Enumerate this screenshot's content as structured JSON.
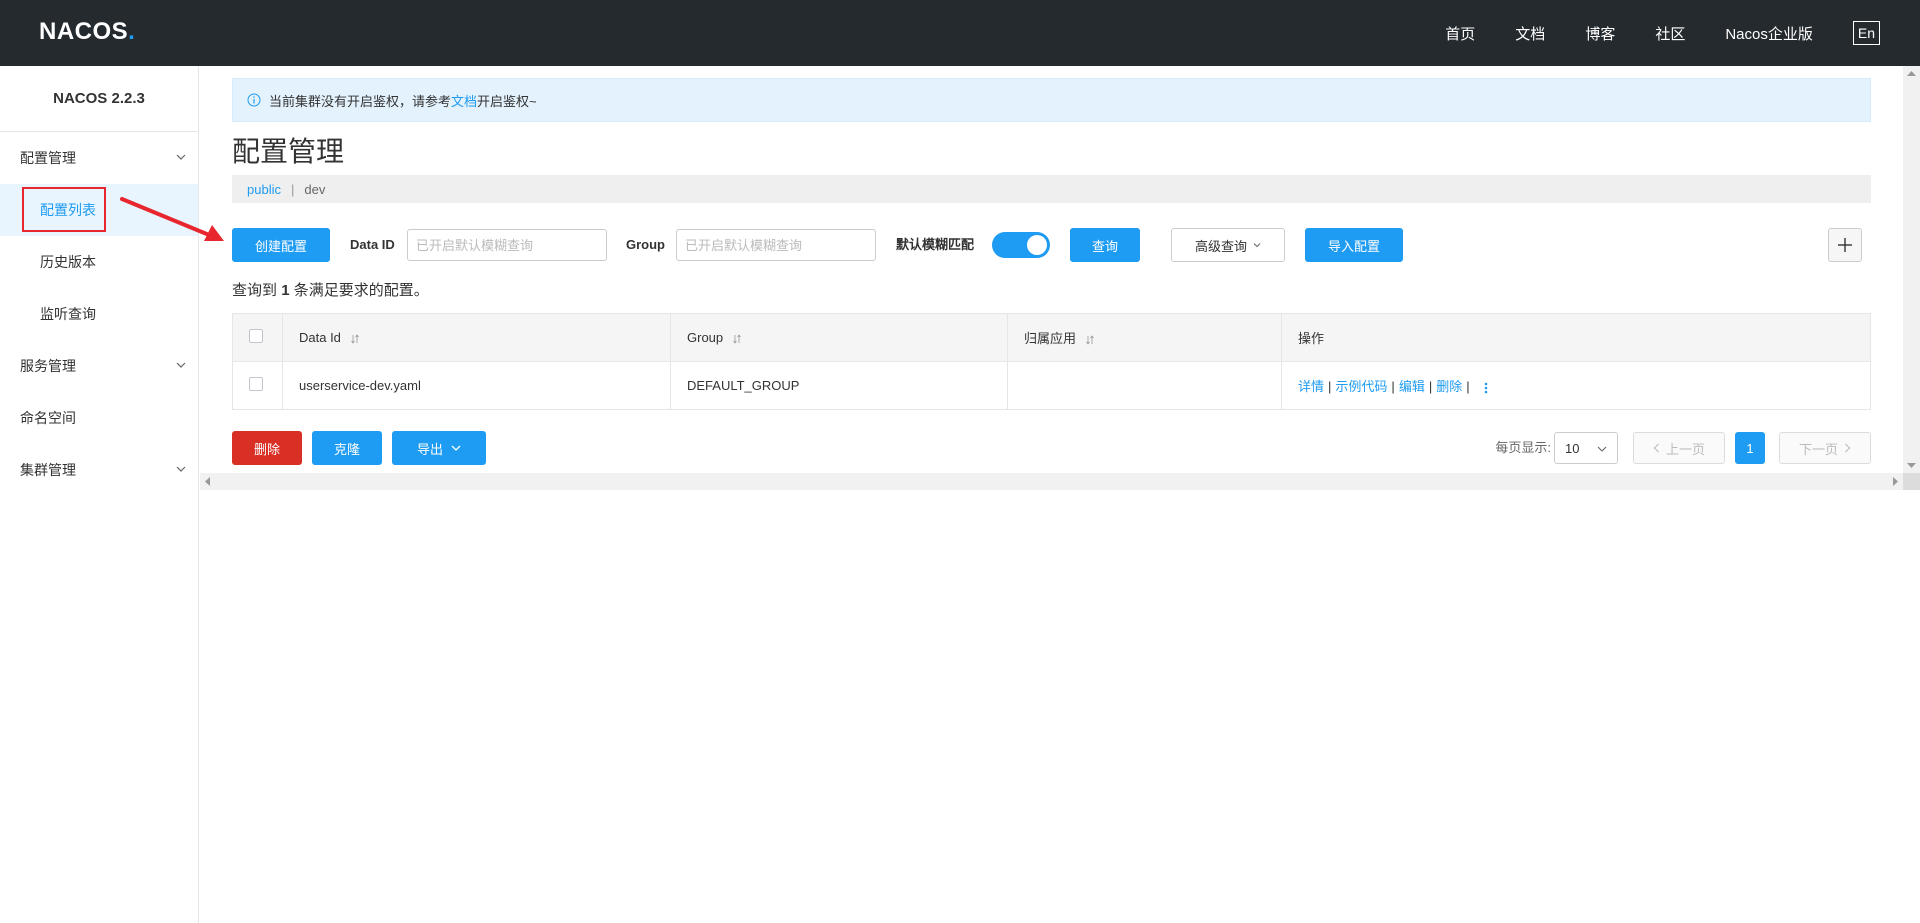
{
  "header": {
    "logo": {
      "text": "NACOS",
      "dot": "."
    },
    "nav": [
      "首页",
      "文档",
      "博客",
      "社区",
      "Nacos企业版"
    ],
    "lang": "En"
  },
  "sidebar": {
    "version": "NACOS 2.2.3",
    "groups": [
      {
        "label": "配置管理",
        "items": [
          "配置列表",
          "历史版本",
          "监听查询"
        ]
      },
      {
        "label": "服务管理"
      },
      {
        "label": "命名空间"
      },
      {
        "label": "集群管理"
      }
    ]
  },
  "notice": {
    "text_before": "当前集群没有开启鉴权，请参考",
    "link": "文档",
    "text_after": "开启鉴权~"
  },
  "page": {
    "title": "配置管理",
    "namespaces": {
      "public": "public",
      "separator": "|",
      "dev": "dev"
    }
  },
  "toolbar": {
    "create_label": "创建配置",
    "dataid_label": "Data ID",
    "dataid_placeholder": "已开启默认模糊查询",
    "group_label": "Group",
    "group_placeholder": "已开启默认模糊查询",
    "fuzzy_label": "默认模糊匹配",
    "fuzzy_enabled": true,
    "query_label": "查询",
    "advanced_label": "高级查询",
    "import_label": "导入配置"
  },
  "results": {
    "prefix": "查询到",
    "count": "1",
    "suffix": "条满足要求的配置。"
  },
  "table": {
    "columns": [
      "Data Id",
      "Group",
      "归属应用",
      "操作"
    ],
    "rows": [
      {
        "data_id": "userservice-dev.yaml",
        "group": "DEFAULT_GROUP",
        "app": "",
        "ops": [
          "详情",
          "示例代码",
          "编辑",
          "删除"
        ],
        "sep": "|"
      }
    ]
  },
  "bottom": {
    "delete_label": "删除",
    "clone_label": "克隆",
    "export_label": "导出",
    "page_size_label": "每页显示:",
    "page_size": "10",
    "prev_label": "上一页",
    "current_page": "1",
    "next_label": "下一页"
  },
  "colors": {
    "primary": "#1e9bf2",
    "danger": "#d93026",
    "header_bg": "#252a2f",
    "annotation": "#e8262e"
  }
}
